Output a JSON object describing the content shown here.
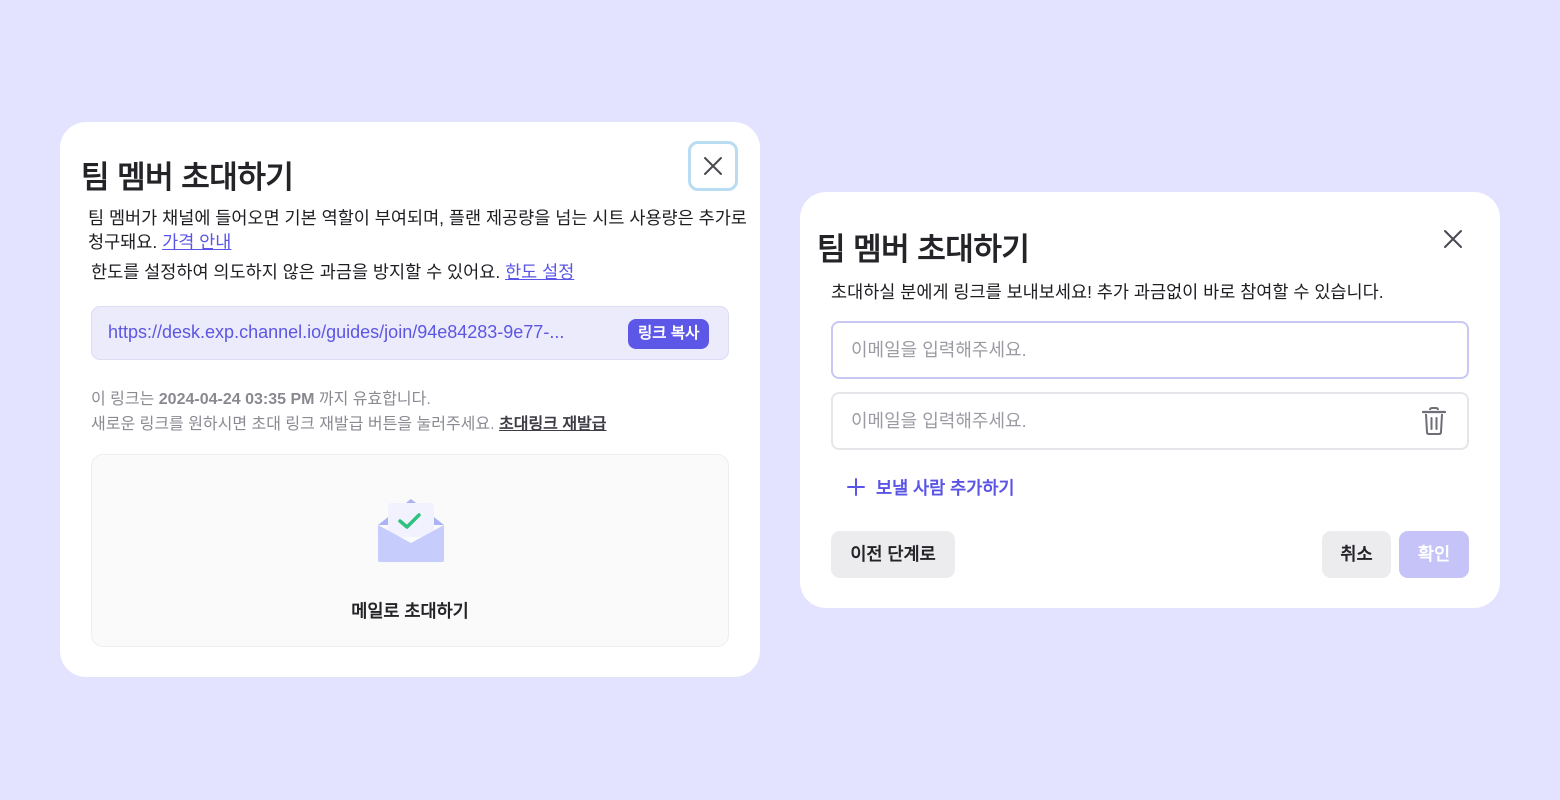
{
  "colors": {
    "background": "#e3e2ff",
    "accent": "#5d57e8",
    "link": "#5a55e6",
    "confirm_disabled": "#c5c3f8",
    "mail_icon_check": "#2fc27e"
  },
  "left_modal": {
    "title": "팀 멤버 초대하기",
    "close_icon": "close-icon",
    "description": {
      "text": "팀 멤버가 채널에 들어오면 기본 역할이 부여되며, 플랜 제공량을 넘는 시트 사용량은 추가로 청구돼요. ",
      "link": "가격 안내"
    },
    "limit": {
      "text": "한도를 설정하여 의도하지 않은 과금을 방지할 수 있어요. ",
      "link": "한도 설정"
    },
    "invite_link": {
      "url": "https://desk.exp.channel.io/guides/join/94e84283-9e77-...",
      "copy_label": "링크 복사"
    },
    "validity": {
      "prefix": "이 링크는 ",
      "date": "2024-04-24 03:35 PM",
      "suffix": " 까지 유효합니다."
    },
    "reissue": {
      "text": "새로운 링크를 원하시면 초대 링크 재발급 버튼을 눌러주세요. ",
      "link": "초대링크 재발급"
    },
    "mail_invite": {
      "icon": "envelope-check-icon",
      "label": "메일로 초대하기"
    }
  },
  "right_modal": {
    "title": "팀 멤버 초대하기",
    "close_icon": "close-icon",
    "description": "초대하실 분에게 링크를 보내보세요! 추가 과금없이 바로 참여할 수 있습니다.",
    "email_inputs": [
      {
        "placeholder": "이메일을 입력해주세요.",
        "value": ""
      },
      {
        "placeholder": "이메일을 입력해주세요.",
        "value": "",
        "delete_icon": "trash-icon"
      }
    ],
    "add_recipient": {
      "icon": "plus-icon",
      "label": "보낼 사람 추가하기"
    },
    "buttons": {
      "prev": "이전 단계로",
      "cancel": "취소",
      "confirm": "확인"
    }
  }
}
